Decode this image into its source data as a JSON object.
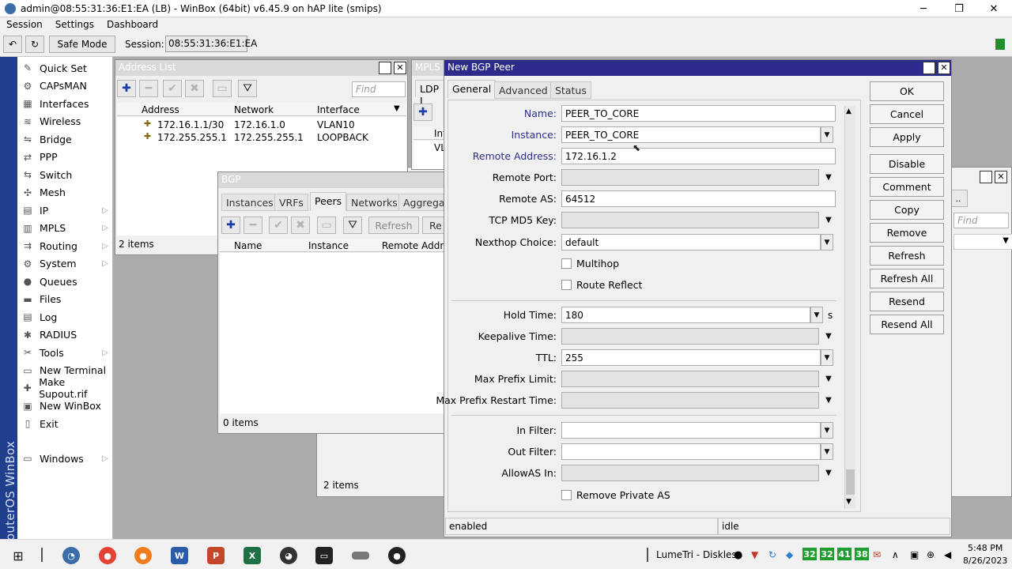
{
  "window": {
    "title": "admin@08:55:31:36:E1:EA (LB) - WinBox (64bit) v6.45.9 on hAP lite (smips)",
    "minimize": "─",
    "restore": "❐",
    "close": "✕"
  },
  "menu": [
    "Session",
    "Settings",
    "Dashboard"
  ],
  "toolbar": {
    "undo": "↶",
    "redo": "↻",
    "safe_mode": "Safe Mode",
    "session_label": "Session:",
    "session_value": "08:55:31:36:E1:EA"
  },
  "side_label": "RouterOS WinBox",
  "sidebar": [
    {
      "label": "Quick Set",
      "icon": "quick-set-icon",
      "glyph": "✎",
      "arrow": ""
    },
    {
      "label": "CAPsMAN",
      "icon": "capsman-icon",
      "glyph": "⚙",
      "arrow": ""
    },
    {
      "label": "Interfaces",
      "icon": "interfaces-icon",
      "glyph": "▦",
      "arrow": ""
    },
    {
      "label": "Wireless",
      "icon": "wireless-icon",
      "glyph": "≋",
      "arrow": ""
    },
    {
      "label": "Bridge",
      "icon": "bridge-icon",
      "glyph": "⇋",
      "arrow": ""
    },
    {
      "label": "PPP",
      "icon": "ppp-icon",
      "glyph": "⇄",
      "arrow": ""
    },
    {
      "label": "Switch",
      "icon": "switch-icon",
      "glyph": "⇆",
      "arrow": ""
    },
    {
      "label": "Mesh",
      "icon": "mesh-icon",
      "glyph": "✣",
      "arrow": ""
    },
    {
      "label": "IP",
      "icon": "ip-icon",
      "glyph": "▤",
      "arrow": "▷"
    },
    {
      "label": "MPLS",
      "icon": "mpls-icon",
      "glyph": "▥",
      "arrow": "▷"
    },
    {
      "label": "Routing",
      "icon": "routing-icon",
      "glyph": "⇉",
      "arrow": "▷"
    },
    {
      "label": "System",
      "icon": "system-icon",
      "glyph": "⚙",
      "arrow": "▷"
    },
    {
      "label": "Queues",
      "icon": "queues-icon",
      "glyph": "●",
      "arrow": ""
    },
    {
      "label": "Files",
      "icon": "files-icon",
      "glyph": "▬",
      "arrow": ""
    },
    {
      "label": "Log",
      "icon": "log-icon",
      "glyph": "▤",
      "arrow": ""
    },
    {
      "label": "RADIUS",
      "icon": "radius-icon",
      "glyph": "✱",
      "arrow": ""
    },
    {
      "label": "Tools",
      "icon": "tools-icon",
      "glyph": "✂",
      "arrow": "▷"
    },
    {
      "label": "New Terminal",
      "icon": "terminal-icon",
      "glyph": "▭",
      "arrow": ""
    },
    {
      "label": "Make Supout.rif",
      "icon": "supout-icon",
      "glyph": "✚",
      "arrow": ""
    },
    {
      "label": "New WinBox",
      "icon": "winbox-icon",
      "glyph": "▣",
      "arrow": ""
    },
    {
      "label": "Exit",
      "icon": "exit-icon",
      "glyph": "▯",
      "arrow": ""
    }
  ],
  "sidebar_windows": {
    "label": "Windows",
    "icon": "windows-icon",
    "glyph": "▭",
    "arrow": "▷"
  },
  "address_list": {
    "title": "Address List",
    "find": "Find",
    "columns": [
      "Address",
      "Network",
      "Interface"
    ],
    "rows": [
      {
        "address": "172.16.1.1/30",
        "network": "172.16.1.0",
        "interface": "VLAN10"
      },
      {
        "address": "172.255.255.1",
        "network": "172.255.255.1",
        "interface": "LOOPBACK"
      }
    ],
    "footer": "2 items"
  },
  "mpls": {
    "title": "MPLS",
    "tab": "LDP I",
    "col": "Int",
    "row": "VL"
  },
  "bg_window": {
    "footer": "2 items",
    "find": "Find"
  },
  "bgp": {
    "title": "BGP",
    "tabs": [
      "Instances",
      "VRFs",
      "Peers",
      "Networks",
      "Aggrega"
    ],
    "refresh": "Refresh",
    "re": "Re",
    "columns": [
      "Name",
      "Instance",
      "Remote Addr"
    ],
    "footer": "0 items"
  },
  "peer": {
    "title": "New BGP Peer",
    "tabs": [
      "General",
      "Advanced",
      "Status"
    ],
    "fields": {
      "name": {
        "label": "Name:",
        "value": "PEER_TO_CORE"
      },
      "instance": {
        "label": "Instance:",
        "value": "PEER_TO_CORE"
      },
      "remote_address": {
        "label": "Remote Address:",
        "value": "172.16.1.2"
      },
      "remote_port": {
        "label": "Remote Port:",
        "value": ""
      },
      "remote_as": {
        "label": "Remote AS:",
        "value": "64512"
      },
      "tcp_md5": {
        "label": "TCP MD5 Key:",
        "value": ""
      },
      "nexthop": {
        "label": "Nexthop Choice:",
        "value": "default"
      },
      "multihop": {
        "label": "Multihop"
      },
      "route_reflect": {
        "label": "Route Reflect"
      },
      "hold_time": {
        "label": "Hold Time:",
        "value": "180",
        "unit": "s"
      },
      "keepalive": {
        "label": "Keepalive Time:",
        "value": ""
      },
      "ttl": {
        "label": "TTL:",
        "value": "255"
      },
      "max_prefix_limit": {
        "label": "Max Prefix Limit:",
        "value": ""
      },
      "max_prefix_restart": {
        "label": "Max Prefix Restart Time:",
        "value": ""
      },
      "in_filter": {
        "label": "In Filter:",
        "value": ""
      },
      "out_filter": {
        "label": "Out Filter:",
        "value": ""
      },
      "allowas_in": {
        "label": "AllowAS In:",
        "value": ""
      },
      "remove_private_as": {
        "label": "Remove Private AS"
      }
    },
    "buttons": [
      "OK",
      "Cancel",
      "Apply",
      "Disable",
      "Comment",
      "Copy",
      "Remove",
      "Refresh",
      "Refresh All",
      "Resend",
      "Resend All"
    ],
    "status_left": "enabled",
    "status_right": "idle"
  },
  "taskbar": {
    "tray_label": "LumeTri - Diskless",
    "counters": [
      "32",
      "32",
      "41",
      "38"
    ],
    "time": "5:48 PM",
    "date": "8/26/2023"
  },
  "colors": {
    "active_title": "#2b2b8c",
    "side_label_bg": "#1f3e8c",
    "counter_green": "#1f9e2f"
  }
}
